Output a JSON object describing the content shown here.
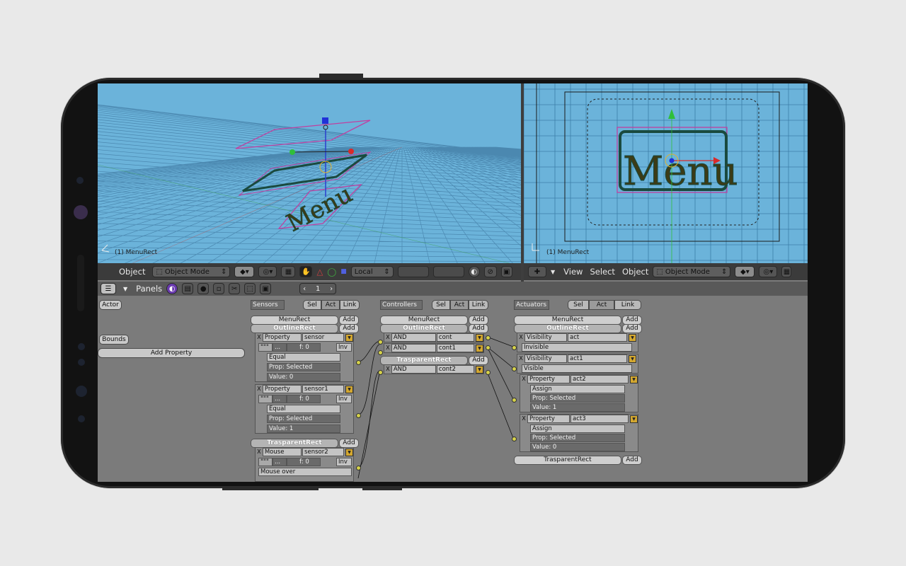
{
  "viewport_left": {
    "label": "(1) MenuRect"
  },
  "viewport_right": {
    "label": "(1) MenuRect"
  },
  "header_left": {
    "menu_object": "Object",
    "mode": "Object Mode",
    "orientation": "Local"
  },
  "header_right": {
    "menu_view": "View",
    "menu_select": "Select",
    "menu_object": "Object",
    "mode": "Object Mode"
  },
  "logic_header": {
    "panels_label": "Panels",
    "frame": "1"
  },
  "properties": {
    "actor": "Actor",
    "bounds": "Bounds",
    "add_property": "Add Property"
  },
  "columns": {
    "sensors": "Sensors",
    "controllers": "Controllers",
    "actuators": "Actuators",
    "sel": "Sel",
    "act": "Act",
    "link": "Link",
    "add": "Add"
  },
  "objects": {
    "menu": "MenuRect",
    "outline": "OutlineRect",
    "trasparent": "TrasparentRect"
  },
  "sensors": [
    {
      "type": "Property",
      "name": "sensor",
      "freq": "f: 0",
      "inv": "Inv",
      "eval": "Equal",
      "prop": "Prop: Selected",
      "value": "Value: 0"
    },
    {
      "type": "Property",
      "name": "sensor1",
      "freq": "f: 0",
      "inv": "Inv",
      "eval": "Equal",
      "prop": "Prop: Selected",
      "value": "Value: 1"
    },
    {
      "type": "Mouse",
      "name": "sensor2",
      "freq": "f: 0",
      "inv": "Inv",
      "eval": "Mouse over"
    }
  ],
  "pulse": "\"\"\"",
  "dots": "...",
  "controllers": [
    {
      "type": "AND",
      "name": "cont"
    },
    {
      "type": "AND",
      "name": "cont1"
    },
    {
      "type": "AND",
      "name": "cont2"
    }
  ],
  "actuators": [
    {
      "type": "Visibility",
      "name": "act",
      "mode": "Invisible"
    },
    {
      "type": "Visibility",
      "name": "act1",
      "mode": "Visible"
    },
    {
      "type": "Property",
      "name": "act2",
      "mode": "Assign",
      "prop": "Prop: Selected",
      "value": "Value: 1"
    },
    {
      "type": "Property",
      "name": "act3",
      "mode": "Assign",
      "prop": "Prop: Selected",
      "value": "Value: 0"
    }
  ],
  "menu_text": "Menu",
  "colors": {
    "viewport": "#6bb3da",
    "panel_bg": "#7b7b7b",
    "link_dot": "#d6d24a",
    "frame": "#121212"
  }
}
